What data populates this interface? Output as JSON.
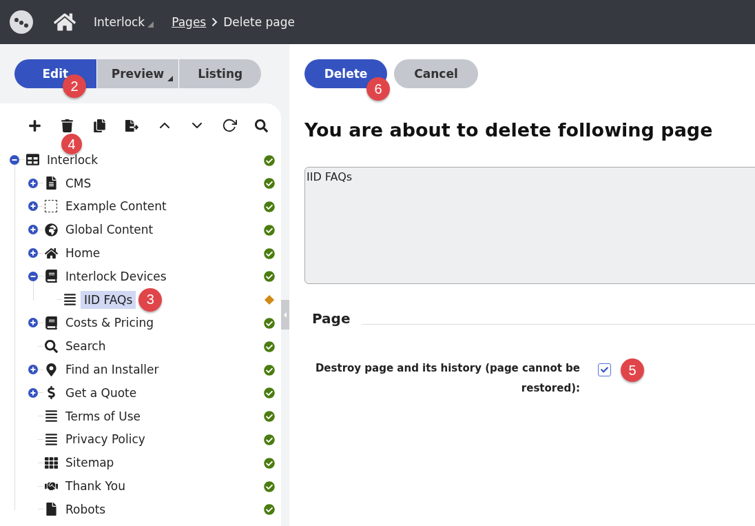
{
  "topbar": {
    "site": "Interlock",
    "breadcrumbs": [
      {
        "label": "Pages",
        "kind": "link"
      },
      {
        "label": "Delete page",
        "kind": "current"
      }
    ]
  },
  "tabs": [
    {
      "label": "Edit",
      "selected": true,
      "dropdown": false,
      "badge": "2"
    },
    {
      "label": "Preview",
      "selected": false,
      "dropdown": true
    },
    {
      "label": "Listing",
      "selected": false,
      "dropdown": false
    }
  ],
  "toolbar": {
    "badge": "4"
  },
  "tree": [
    {
      "label": "Interlock",
      "kind": "layout",
      "expanded": true,
      "published": true,
      "selected": false,
      "children": [
        {
          "label": "CMS",
          "kind": "text",
          "expanded": false,
          "published": true,
          "selected": false
        },
        {
          "label": "Example Content",
          "kind": "placeholder",
          "expanded": false,
          "published": true,
          "selected": false
        },
        {
          "label": "Global Content",
          "kind": "globe",
          "expanded": false,
          "published": true,
          "selected": false
        },
        {
          "label": "Home",
          "kind": "home",
          "expanded": false,
          "published": true,
          "selected": false
        },
        {
          "label": "Interlock Devices",
          "kind": "book",
          "expanded": true,
          "published": true,
          "selected": false,
          "children": [
            {
              "label": "IID FAQs",
              "kind": "lines",
              "published": false,
              "selected": true,
              "badge": "3"
            }
          ]
        },
        {
          "label": "Costs & Pricing",
          "kind": "book",
          "expanded": false,
          "published": true,
          "selected": false
        },
        {
          "label": "Search",
          "kind": "search",
          "published": true,
          "selected": false
        },
        {
          "label": "Find an Installer",
          "kind": "pin",
          "expanded": false,
          "published": true,
          "selected": false
        },
        {
          "label": "Get a Quote",
          "kind": "dollar",
          "expanded": false,
          "published": true,
          "selected": false
        },
        {
          "label": "Terms of Use",
          "kind": "lines",
          "published": true,
          "selected": false
        },
        {
          "label": "Privacy Policy",
          "kind": "lines",
          "published": true,
          "selected": false
        },
        {
          "label": "Sitemap",
          "kind": "grid",
          "published": true,
          "selected": false
        },
        {
          "label": "Thank You",
          "kind": "handshake",
          "published": true,
          "selected": false
        },
        {
          "label": "Robots",
          "kind": "file",
          "published": true,
          "selected": false
        }
      ]
    }
  ],
  "actions": [
    {
      "label": "Delete",
      "kind": "primary",
      "badge": "6"
    },
    {
      "label": "Cancel",
      "kind": "secondary"
    }
  ],
  "heading": "You are about to delete following page",
  "pages_box": {
    "value": "IID FAQs"
  },
  "fieldset": {
    "legend": "Page",
    "field": {
      "label": "Destroy page and its history (page cannot be restored):",
      "checked": true,
      "badge": "5"
    }
  }
}
